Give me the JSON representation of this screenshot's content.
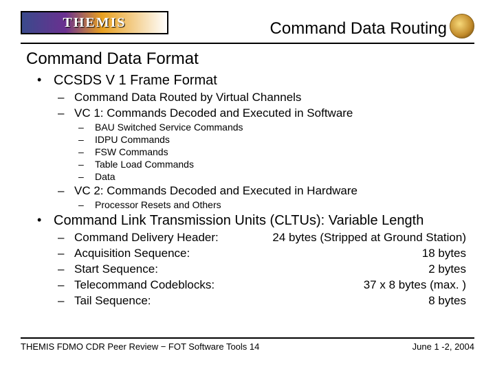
{
  "header": {
    "logo_text": "THEMIS",
    "slide_title": "Command Data Routing"
  },
  "section_title": "Command Data Format",
  "bullets": {
    "b1": "CCSDS V 1 Frame Format",
    "b1_1": "Command Data Routed by Virtual Channels",
    "b1_2": "VC 1:  Commands Decoded and Executed in Software",
    "b1_2_1": "BAU Switched Service Commands",
    "b1_2_2": "IDPU Commands",
    "b1_2_3": "FSW Commands",
    "b1_2_4": "Table Load Commands",
    "b1_2_5": "Data",
    "b1_3": "VC 2:  Commands Decoded and Executed in Hardware",
    "b1_3_1": "Processor Resets and Others",
    "b2": "Command Link Transmission Units (CLTUs): Variable Length",
    "b2_1_label": "Command Delivery Header:",
    "b2_1_value": "24 bytes (Stripped at Ground Station)",
    "b2_2_label": "Acquisition Sequence:",
    "b2_2_value": "18 bytes",
    "b2_3_label": "Start Sequence:",
    "b2_3_value": "2 bytes",
    "b2_4_label": "Telecommand Codeblocks:",
    "b2_4_value": "37 x 8 bytes (max. )",
    "b2_5_label": "Tail Sequence:",
    "b2_5_value": "8 bytes"
  },
  "footer": {
    "left": "THEMIS FDMO CDR Peer Review − FOT Software Tools 14",
    "right": "June 1 -2, 2004"
  }
}
